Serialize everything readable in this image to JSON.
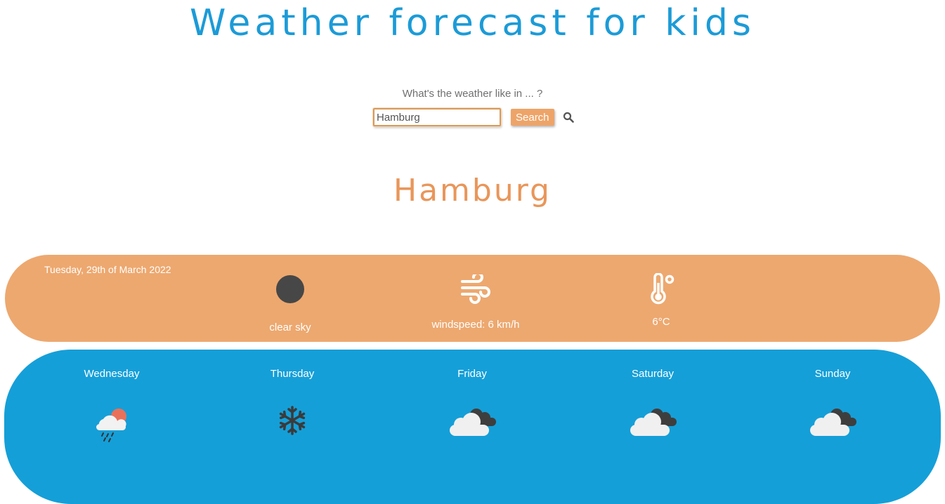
{
  "header": {
    "title": "Weather forecast for kids"
  },
  "search": {
    "prompt": "What's the weather like in ... ?",
    "value": "Hamburg",
    "button_label": "Search",
    "icon": "search-icon"
  },
  "city": {
    "name": "Hamburg"
  },
  "today": {
    "date": "Tuesday, 29th of March 2022",
    "condition": {
      "icon": "clear-sky-icon",
      "label": "clear sky"
    },
    "wind": {
      "icon": "wind-icon",
      "label": "windspeed: 6 km/h"
    },
    "temperature": {
      "icon": "thermometer-icon",
      "label": "6°C"
    }
  },
  "forecast": [
    {
      "day": "Wednesday",
      "icon": "rain-sun-cloud-icon"
    },
    {
      "day": "Thursday",
      "icon": "snowflake-icon"
    },
    {
      "day": "Friday",
      "icon": "cloudy-icon"
    },
    {
      "day": "Saturday",
      "icon": "cloudy-icon"
    },
    {
      "day": "Sunday",
      "icon": "cloudy-icon"
    }
  ],
  "colors": {
    "title": "#1c9bd7",
    "accent_orange": "#eda86f",
    "city_orange": "#e9965a",
    "forecast_blue": "#159fd8"
  }
}
